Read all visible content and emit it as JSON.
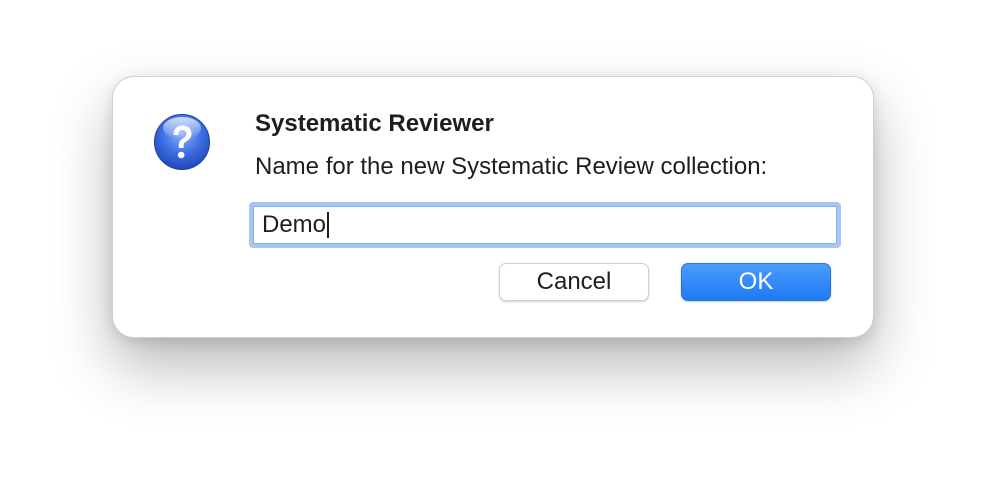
{
  "dialog": {
    "title": "Systematic Reviewer",
    "message": "Name for the new Systematic Review collection:",
    "icon": "question-mark-icon",
    "input": {
      "value": "Demo"
    },
    "buttons": {
      "cancel_label": "Cancel",
      "ok_label": "OK"
    }
  },
  "colors": {
    "accent": "#1f7bf2",
    "focus_ring": "#a9c6f3",
    "icon_blue": "#3a6fe0"
  }
}
